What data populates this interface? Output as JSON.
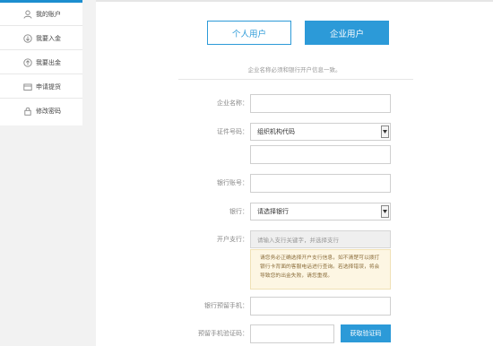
{
  "sidebar": {
    "items": [
      {
        "label": "我的账户",
        "icon": "user-icon"
      },
      {
        "label": "我要入金",
        "icon": "deposit-icon"
      },
      {
        "label": "我要出金",
        "icon": "withdraw-icon"
      },
      {
        "label": "申请提货",
        "icon": "delivery-icon"
      },
      {
        "label": "修改密码",
        "icon": "lock-icon"
      }
    ]
  },
  "tabs": {
    "personal": "个人用户",
    "business": "企业用户"
  },
  "notice": "企业名称必须和银行开户信息一致。",
  "form": {
    "company_name_label": "企业名称：",
    "certificate_label": "证件号码：",
    "certificate_type_value": "组织机构代码",
    "bank_account_label": "银行账号：",
    "bank_label": "银行：",
    "bank_select_value": "请选择银行",
    "branch_label": "开户支行：",
    "branch_placeholder": "请输入支行关键字，并选择支行",
    "tip_text": "请您务必正确选择开户支行信息，如不清楚可以拨打银行卡背面的客服电话进行查询。若选择错误，将会导致您的出金失败，请您重视。",
    "phone_label": "银行预留手机：",
    "code_label": "预留手机验证码：",
    "get_code_button": "获取验证码"
  },
  "colors": {
    "accent": "#2c9ad8",
    "tip_bg": "#fdf6e3"
  }
}
